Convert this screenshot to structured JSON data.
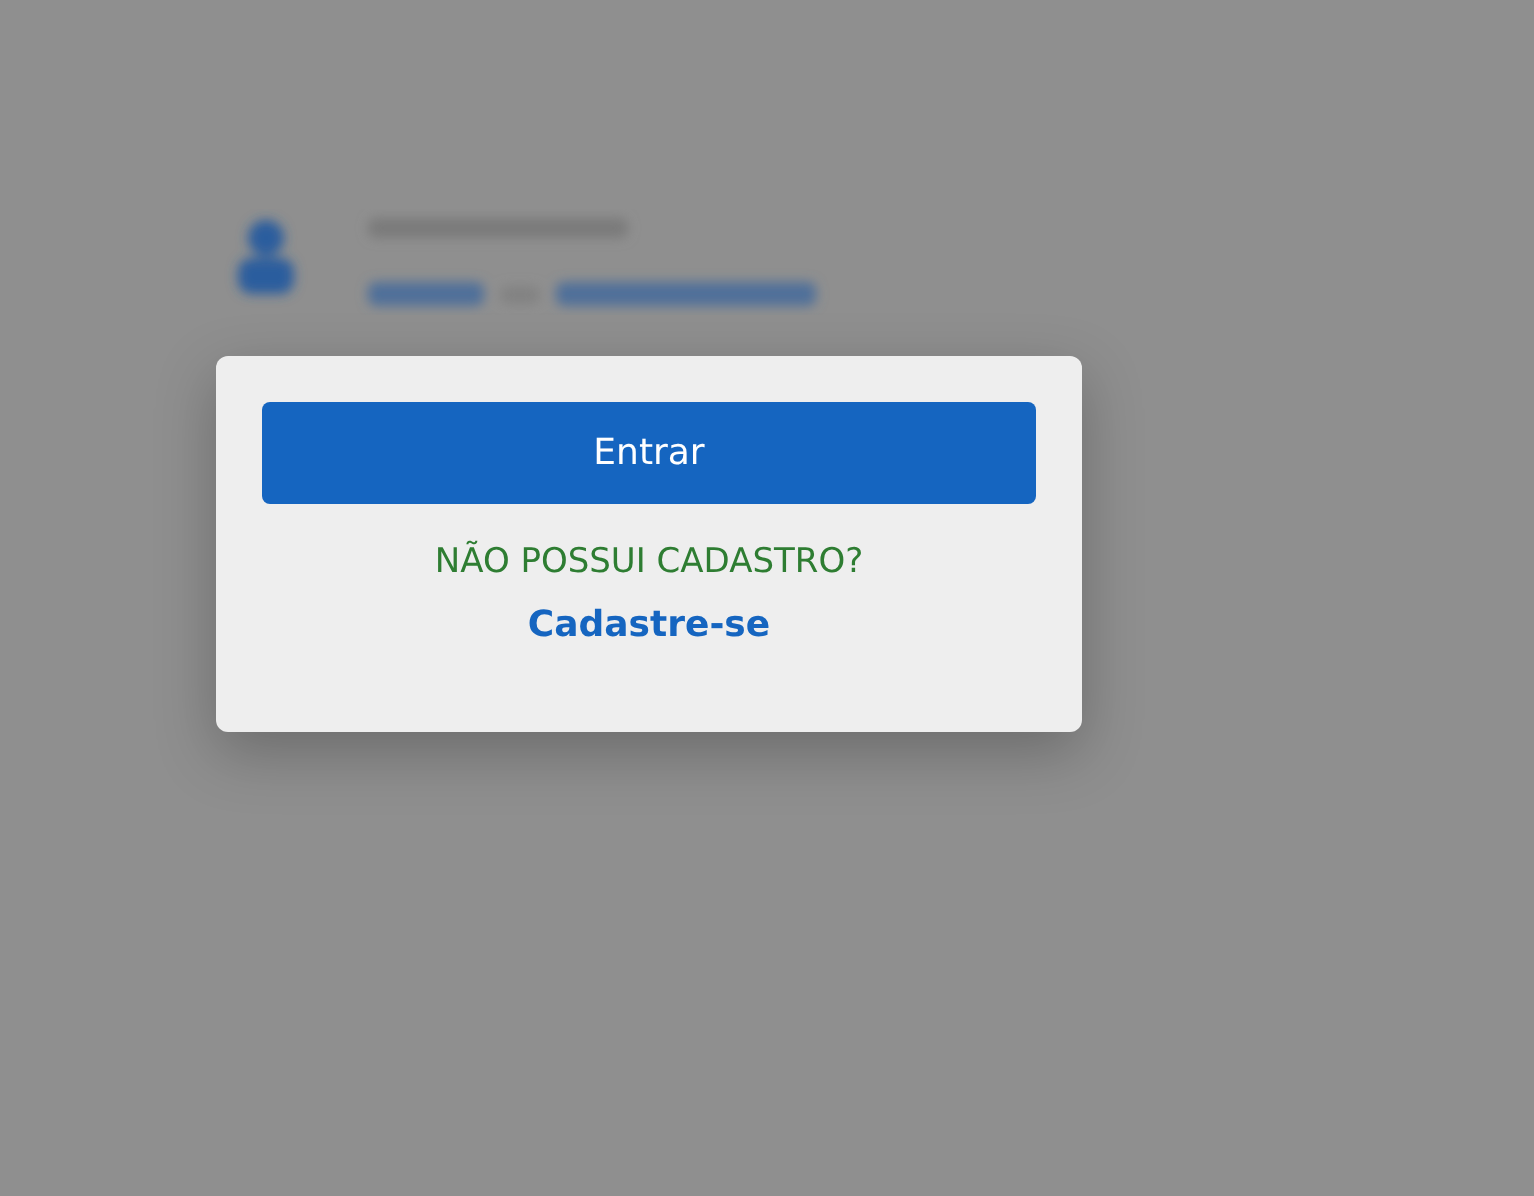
{
  "popup": {
    "button": "Entrar",
    "prompt": "NÃO POSSUI CADASTRO?",
    "link": "Cadastre-se"
  }
}
